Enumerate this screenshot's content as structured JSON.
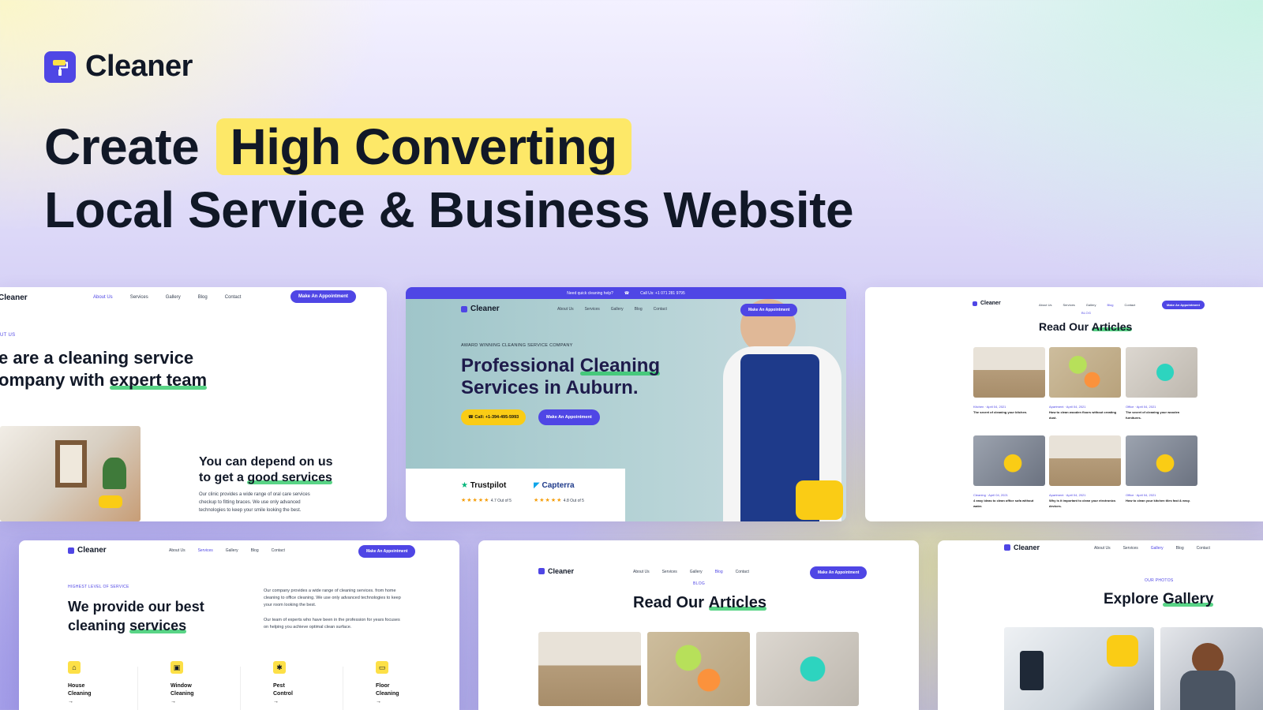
{
  "brand": {
    "name": "Cleaner"
  },
  "headline": {
    "part1": "Create",
    "highlight": "High Converting",
    "line2": "Local Service & Business Website"
  },
  "colors": {
    "accent": "#4f46e5",
    "highlight": "#fde868",
    "underline": "#22c55e",
    "cta_yellow": "#facc15"
  },
  "nav": {
    "about": "About Us",
    "services": "Services",
    "gallery": "Gallery",
    "blog": "Blog",
    "contact": "Contact",
    "cta": "Make An Appointment"
  },
  "about_card": {
    "logo": "Cleaner",
    "kicker": "UT US",
    "title_a": "e are a cleaning service",
    "title_b": "ompany with ",
    "title_ul": "expert team",
    "sub_a": "You can depend on us",
    "sub_b": "to get a ",
    "sub_ul": "good services",
    "body": "Our clinic provides a wide range of oral care services checkup to fitting braces. We use only advanced technologies to keep your smile looking the best."
  },
  "hero_card": {
    "topbar_q": "Need quick cleaning help?",
    "topbar_call": "Call Us: +1 071 281 9795",
    "logo": "Cleaner",
    "kicker": "AWARD WINNING CLEANING SERVICE COMPANY",
    "title_a": "Professional ",
    "title_ul": "Cleaning",
    "title_b": "Services in Auburn.",
    "call_btn": "Call: +1-394-495-5993",
    "cta_btn": "Make An Appointment",
    "trustpilot": {
      "name": "Trustpilot",
      "rating": "4.7 Out of 5"
    },
    "capterra": {
      "name": "Capterra",
      "rating": "4.8 Out of 5"
    }
  },
  "articles_card_top": {
    "logo": "Cleaner",
    "kicker": "BLOG",
    "title_a": "Read Our ",
    "title_ul": "Articles",
    "posts": [
      {
        "tag": "Kitchen",
        "date": "April 04, 2021",
        "title": "The secret of cleaning your kitchen."
      },
      {
        "tag": "Apartment",
        "date": "April 04, 2021",
        "title": "How to clean wooden floors without creating dust."
      },
      {
        "tag": "Office",
        "date": "April 04, 2021",
        "title": "The secret of cleaning your wooden furnitures."
      },
      {
        "tag": "Cleaning",
        "date": "April 04, 2021",
        "title": "4 easy ideas to clean office sofa without water."
      },
      {
        "tag": "Apartment",
        "date": "April 04, 2021",
        "title": "Why is it important to clean your electronics devices."
      },
      {
        "tag": "Office",
        "date": "April 04, 2021",
        "title": "How to clean your kitchen tiles fast & easy."
      }
    ]
  },
  "services_card": {
    "logo": "Cleaner",
    "kicker": "HIGHEST LEVEL OF SERVICE",
    "title_a": "We provide our best",
    "title_b": "cleaning ",
    "title_ul": "services",
    "p1": "Our company provides a wide range of cleaning services. from home cleaning to office cleaning. We use only advanced technologies to keep your room looking the best.",
    "p2": "Our team of experts who have been in the profession for years focuses on helping you achieve optimal clean surface.",
    "items": [
      {
        "l1": "House",
        "l2": "Cleaning",
        "icon": "house-icon",
        "glyph": "⌂"
      },
      {
        "l1": "Window",
        "l2": "Cleaning",
        "icon": "window-icon",
        "glyph": "▣"
      },
      {
        "l1": "Pest",
        "l2": "Control",
        "icon": "pest-icon",
        "glyph": "✱"
      },
      {
        "l1": "Floor",
        "l2": "Cleaning",
        "icon": "floor-icon",
        "glyph": "▭"
      }
    ],
    "arrow": "→"
  },
  "articles_card_bottom": {
    "logo": "Cleaner",
    "kicker": "BLOG",
    "title_a": "Read Our ",
    "title_ul": "Articles"
  },
  "gallery_card": {
    "logo": "Cleaner",
    "kicker": "OUR PHOTOS",
    "title_a": "Explore ",
    "title_ul": "Gallery"
  }
}
